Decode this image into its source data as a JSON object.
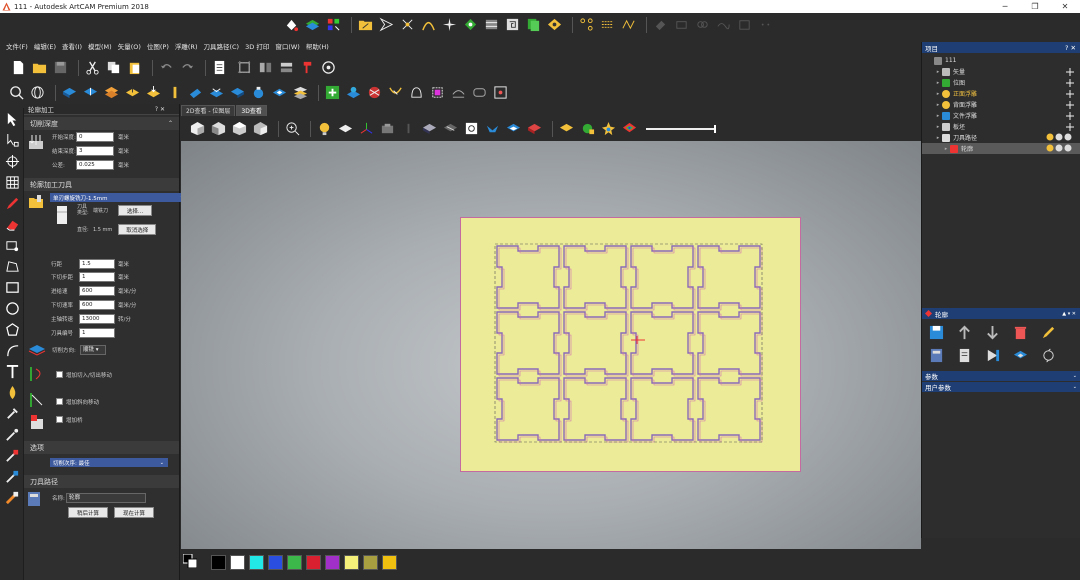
{
  "window": {
    "title": "111 - Autodesk ArtCAM Premium 2018",
    "minimize": "─",
    "restore": "❐",
    "close": "✕"
  },
  "menu": [
    "文件(F)",
    "编辑(E)",
    "查看(I)",
    "模型(M)",
    "矢量(O)",
    "位图(P)",
    "浮雕(R)",
    "刀具路径(C)",
    "3D 打印",
    "窗口(W)",
    "帮助(H)"
  ],
  "left_panel": {
    "title": "轮廓加工",
    "title_buttons": "? ✕",
    "section_depth": "切削深度",
    "start_depth_label": "开始深度:",
    "start_depth_value": "0",
    "end_depth_label": "结束深度:",
    "end_depth_value": "3",
    "tolerance_label": "公差:",
    "tolerance_value": "0.025",
    "unit_mm": "毫米",
    "section_tool": "轮廓加工刀具",
    "tool_name": "单刃螺旋铣刀-1.5mm",
    "tool_type_label": "刀具类型:",
    "tool_type_value": "端铣刀",
    "select_button": "选择...",
    "diameter_label": "直径:",
    "diameter_value": "1.5 mm",
    "deselect_button": "取消选择",
    "stepover_label": "行距",
    "stepover_value": "1.5",
    "stepdown_label": "下切步距",
    "stepdown_value": "1",
    "feed_label": "进给速",
    "feed_value": "600",
    "feed_unit": "毫米/分",
    "plunge_label": "下切速率",
    "plunge_value": "600",
    "spindle_label": "主轴转速",
    "spindle_value": "13000",
    "spindle_unit": "转/分",
    "toolno_label": "刀具编号",
    "toolno_value": "1",
    "cut_dir_label": "切削方向:",
    "cut_dir_value": "顺铣",
    "leadin_label": "增加切入/切出移动",
    "ramp_label": "增加斜向移动",
    "tabs_label": "增加桥",
    "section_options": "选项",
    "order_label": "切削次序: 最佳",
    "section_toolpath": "刀具路径",
    "name_label": "名称:",
    "name_value": "轮廓",
    "calc_later_button": "稍后计算",
    "calc_now_button": "现在计算"
  },
  "view_tabs": [
    "2D查看 - 位图层",
    "3D查看"
  ],
  "right_panel": {
    "project_title": "项目",
    "title_buttons": "? ✕",
    "tree": [
      {
        "label": "111",
        "level": 0,
        "color": "#dddddd"
      },
      {
        "label": "矢量",
        "level": 1,
        "color": "#dddddd"
      },
      {
        "label": "位图",
        "level": 1,
        "color": "#dddddd"
      },
      {
        "label": "正面浮雕",
        "level": 1,
        "color": "#f0c040"
      },
      {
        "label": "背面浮雕",
        "level": 1,
        "color": "#dddddd"
      },
      {
        "label": "文件浮雕",
        "level": 1,
        "color": "#dddddd"
      },
      {
        "label": "板坯",
        "level": 1,
        "color": "#dddddd"
      },
      {
        "label": "刀具路径",
        "level": 1,
        "color": "#dddddd"
      },
      {
        "label": "轮廓",
        "level": 2,
        "color": "#dddddd"
      }
    ],
    "contour_title": "轮廓",
    "params_label": "参数",
    "user_params_label": "用户参数"
  },
  "palette": [
    "#000000",
    "#ffffff",
    "#22e8e8",
    "#2a4ee0",
    "#3cb84a",
    "#d82030",
    "#a030c8",
    "#f5f07a",
    "#a8a040",
    "#f0c010"
  ],
  "colors": {
    "sheet": "#ecec98",
    "sheet_border": "#c46aa0",
    "contour": "#8a6ab8",
    "accent": "#1e3e74"
  }
}
